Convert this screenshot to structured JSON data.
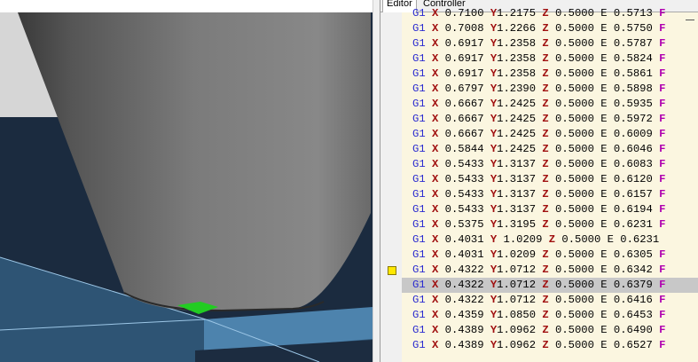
{
  "tabs": [
    {
      "label": "Editor",
      "active": true
    },
    {
      "label": "Controller",
      "active": false
    }
  ],
  "viewport": {
    "colors": {
      "background": "#1b2b3f",
      "light_panel": "#d6d6d6",
      "floor": "#2e5474",
      "floor_light": "#4d83ad",
      "object": "#6e6e6e",
      "path_highlight": "#22cc22"
    }
  },
  "editor": {
    "current_line_index": 18,
    "bookmark_line_index": 17,
    "lines": [
      {
        "cmd": "G1",
        "X": "0.7100",
        "Y": "1.2175",
        "Z": "0.5000",
        "E": "0.5713",
        "F": "F"
      },
      {
        "cmd": "G1",
        "X": "0.7008",
        "Y": "1.2266",
        "Z": "0.5000",
        "E": "0.5750",
        "F": "F"
      },
      {
        "cmd": "G1",
        "X": "0.6917",
        "Y": "1.2358",
        "Z": "0.5000",
        "E": "0.5787",
        "F": "F"
      },
      {
        "cmd": "G1",
        "X": "0.6917",
        "Y": "1.2358",
        "Z": "0.5000",
        "E": "0.5824",
        "F": "F"
      },
      {
        "cmd": "G1",
        "X": "0.6917",
        "Y": "1.2358",
        "Z": "0.5000",
        "E": "0.5861",
        "F": "F"
      },
      {
        "cmd": "G1",
        "X": "0.6797",
        "Y": "1.2390",
        "Z": "0.5000",
        "E": "0.5898",
        "F": "F"
      },
      {
        "cmd": "G1",
        "X": "0.6667",
        "Y": "1.2425",
        "Z": "0.5000",
        "E": "0.5935",
        "F": "F"
      },
      {
        "cmd": "G1",
        "X": "0.6667",
        "Y": "1.2425",
        "Z": "0.5000",
        "E": "0.5972",
        "F": "F"
      },
      {
        "cmd": "G1",
        "X": "0.6667",
        "Y": "1.2425",
        "Z": "0.5000",
        "E": "0.6009",
        "F": "F"
      },
      {
        "cmd": "G1",
        "X": "0.5844",
        "Y": "1.2425",
        "Z": "0.5000",
        "E": "0.6046",
        "F": "F"
      },
      {
        "cmd": "G1",
        "X": "0.5433",
        "Y": "1.3137",
        "Z": "0.5000",
        "E": "0.6083",
        "F": "F"
      },
      {
        "cmd": "G1",
        "X": "0.5433",
        "Y": "1.3137",
        "Z": "0.5000",
        "E": "0.6120",
        "F": "F"
      },
      {
        "cmd": "G1",
        "X": "0.5433",
        "Y": "1.3137",
        "Z": "0.5000",
        "E": "0.6157",
        "F": "F"
      },
      {
        "cmd": "G1",
        "X": "0.5433",
        "Y": "1.3137",
        "Z": "0.5000",
        "E": "0.6194",
        "F": "F"
      },
      {
        "cmd": "G1",
        "X": "0.5375",
        "Y": "1.3195",
        "Z": "0.5000",
        "E": "0.6231",
        "F": "F"
      },
      {
        "cmd": "G1",
        "X": "0.4031",
        "Y": "1.0209",
        "Z": "0.5000",
        "E": "0.6231",
        "F": "",
        "ysep": " "
      },
      {
        "cmd": "G1",
        "X": "0.4031",
        "Y": "1.0209",
        "Z": "0.5000",
        "E": "0.6305",
        "F": "F"
      },
      {
        "cmd": "G1",
        "X": "0.4322",
        "Y": "1.0712",
        "Z": "0.5000",
        "E": "0.6342",
        "F": "F"
      },
      {
        "cmd": "G1",
        "X": "0.4322",
        "Y": "1.0712",
        "Z": "0.5000",
        "E": "0.6379",
        "F": "F"
      },
      {
        "cmd": "G1",
        "X": "0.4322",
        "Y": "1.0712",
        "Z": "0.5000",
        "E": "0.6416",
        "F": "F"
      },
      {
        "cmd": "G1",
        "X": "0.4359",
        "Y": "1.0850",
        "Z": "0.5000",
        "E": "0.6453",
        "F": "F"
      },
      {
        "cmd": "G1",
        "X": "0.4389",
        "Y": "1.0962",
        "Z": "0.5000",
        "E": "0.6490",
        "F": "F"
      },
      {
        "cmd": "G1",
        "X": "0.4389",
        "Y": "1.0962",
        "Z": "0.5000",
        "E": "0.6527",
        "F": "F"
      }
    ]
  }
}
